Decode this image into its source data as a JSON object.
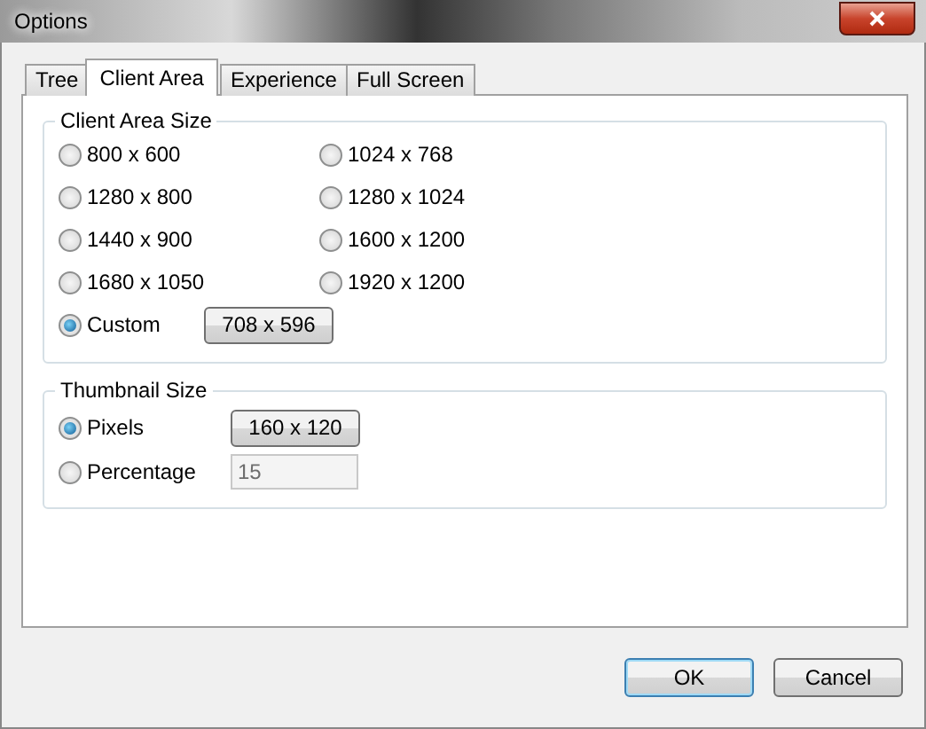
{
  "window": {
    "title": "Options"
  },
  "tabs": [
    {
      "label": "Tree",
      "selected": false
    },
    {
      "label": "Client Area",
      "selected": true
    },
    {
      "label": "Experience",
      "selected": false
    },
    {
      "label": "Full Screen",
      "selected": false
    }
  ],
  "client_area_size": {
    "title": "Client Area Size",
    "options": [
      {
        "label": "800 x 600",
        "selected": false
      },
      {
        "label": "1024 x 768",
        "selected": false
      },
      {
        "label": "1280 x 800",
        "selected": false
      },
      {
        "label": "1280 x 1024",
        "selected": false
      },
      {
        "label": "1440 x 900",
        "selected": false
      },
      {
        "label": "1600 x 1200",
        "selected": false
      },
      {
        "label": "1680 x 1050",
        "selected": false
      },
      {
        "label": "1920 x 1200",
        "selected": false
      },
      {
        "label": "Custom",
        "selected": true,
        "button": "708 x 596"
      }
    ]
  },
  "thumbnail_size": {
    "title": "Thumbnail Size",
    "options": [
      {
        "label": "Pixels",
        "selected": true,
        "kind": "button",
        "value": "160 x 120"
      },
      {
        "label": "Percentage",
        "selected": false,
        "kind": "field",
        "value": "15",
        "disabled": true
      }
    ]
  },
  "buttons": [
    {
      "label": "OK",
      "default": true
    },
    {
      "label": "Cancel",
      "default": false
    }
  ]
}
